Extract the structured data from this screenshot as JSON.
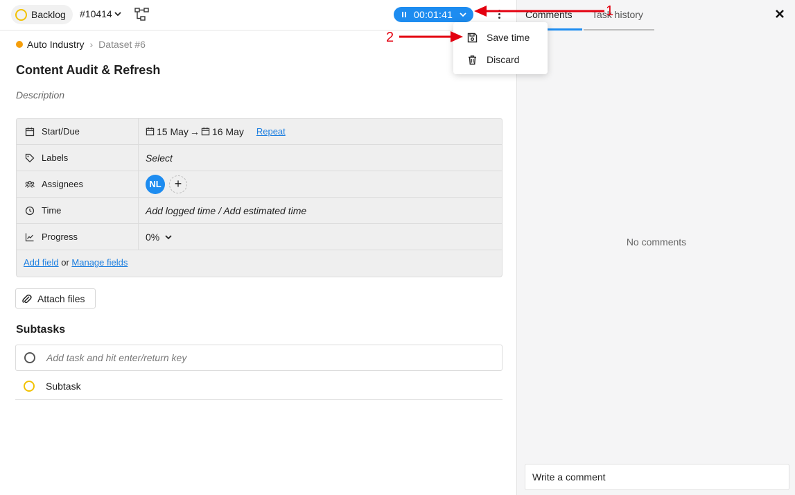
{
  "header": {
    "status": "Backlog",
    "task_id": "#10414",
    "timer": "00:01:41"
  },
  "timer_menu": {
    "items": [
      {
        "label": "Save time",
        "icon": "save-icon"
      },
      {
        "label": "Discard",
        "icon": "trash-icon"
      }
    ]
  },
  "breadcrumb": {
    "project": "Auto Industry",
    "dataset": "Dataset #6"
  },
  "task": {
    "title": "Content Audit & Refresh",
    "description_placeholder": "Description"
  },
  "fields": {
    "start_due": {
      "label": "Start/Due",
      "start": "15 May",
      "due": "16 May",
      "repeat": "Repeat"
    },
    "labels": {
      "label": "Labels",
      "value": "Select"
    },
    "assignees": {
      "label": "Assignees",
      "avatar": "NL"
    },
    "time": {
      "label": "Time",
      "value": "Add logged time / Add estimated time"
    },
    "progress": {
      "label": "Progress",
      "value": "0%"
    },
    "footer": {
      "add_field": "Add field",
      "or": "or",
      "manage_fields": "Manage fields"
    }
  },
  "attach_label": "Attach files",
  "subtasks": {
    "heading": "Subtasks",
    "input_placeholder": "Add task and hit enter/return key",
    "items": [
      {
        "label": "Subtask"
      }
    ]
  },
  "side_panel": {
    "tabs": [
      {
        "label": "Comments"
      },
      {
        "label": "Task history"
      }
    ],
    "empty": "No comments",
    "comment_placeholder": "Write a comment"
  },
  "annotations": [
    "1",
    "2"
  ],
  "colors": {
    "accent": "#1d8cf0",
    "status_ring": "#f2c200",
    "project_dot": "#f59e0b",
    "annotation": "#e3000f"
  }
}
